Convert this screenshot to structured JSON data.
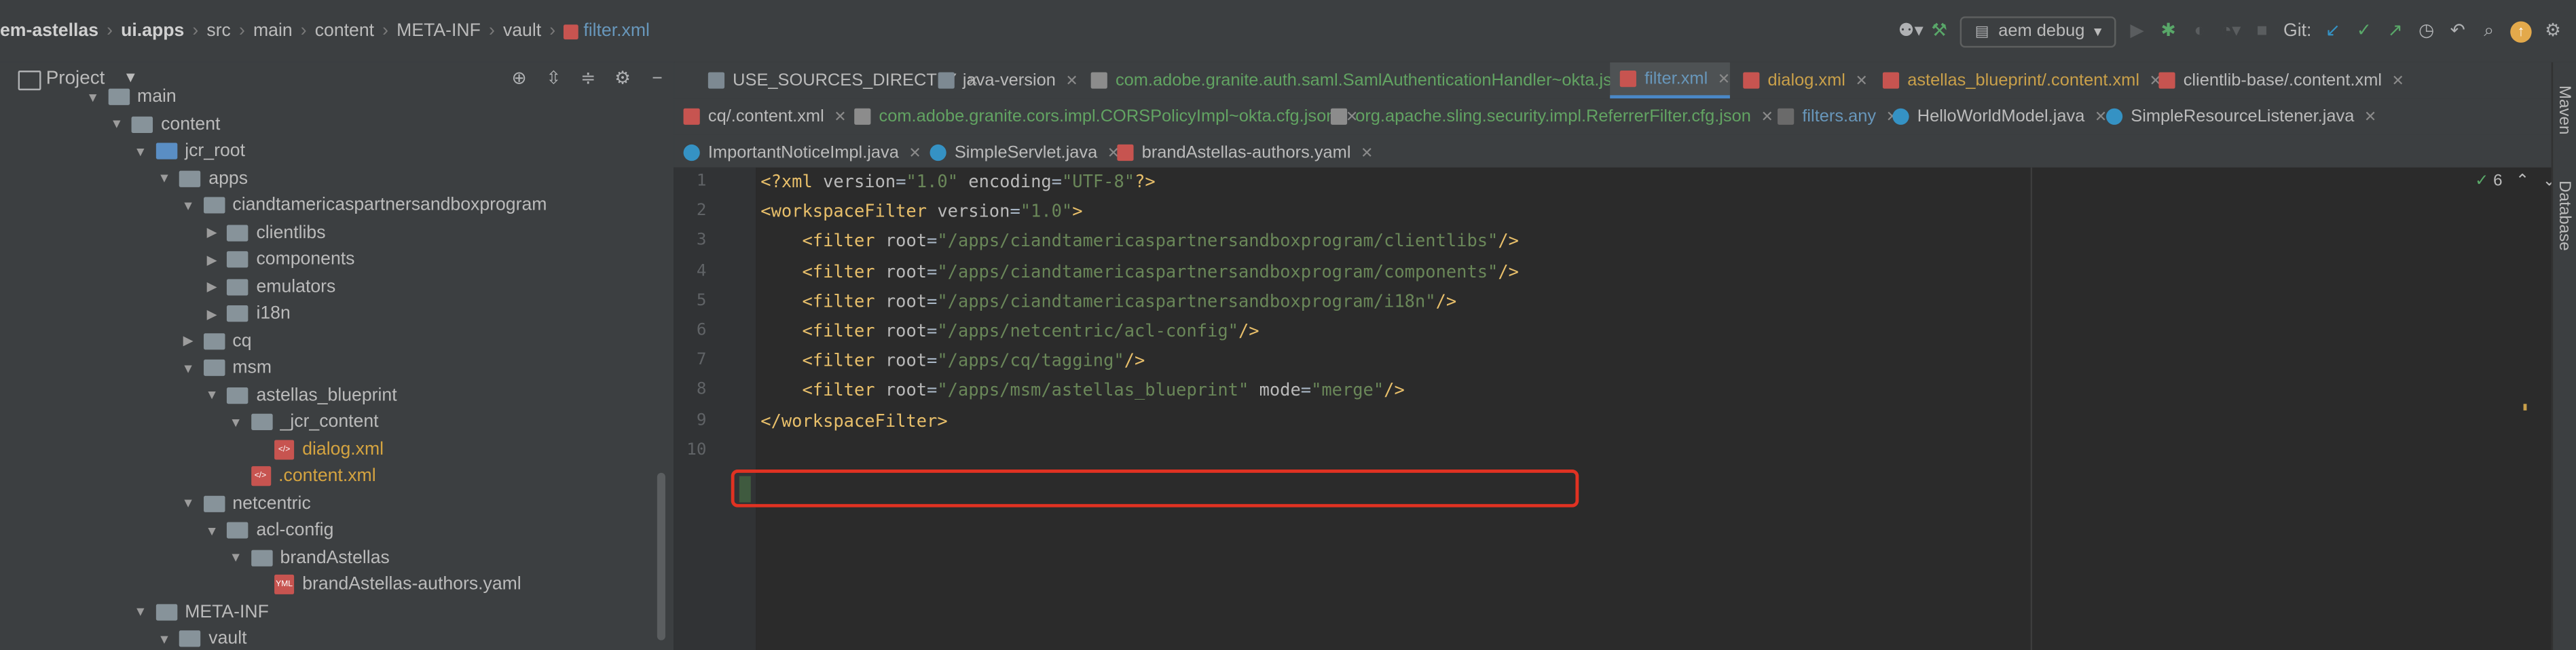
{
  "breadcrumb": {
    "items": [
      "em-astellas",
      "ui.apps",
      "src",
      "main",
      "content",
      "META-INF",
      "vault"
    ],
    "file": "filter.xml"
  },
  "toolbar": {
    "run_config": "aem debug",
    "git_label": "Git:"
  },
  "sidebar": {
    "title": "Project",
    "tree": [
      {
        "label": "main",
        "depth": 3,
        "kind": "folder",
        "open": true
      },
      {
        "label": "content",
        "depth": 4,
        "kind": "folder",
        "open": true
      },
      {
        "label": "jcr_root",
        "depth": 5,
        "kind": "folder-blue",
        "open": true
      },
      {
        "label": "apps",
        "depth": 6,
        "kind": "folder",
        "open": true
      },
      {
        "label": "ciandtamericaspartnersandboxprogram",
        "depth": 7,
        "kind": "folder",
        "open": true
      },
      {
        "label": "clientlibs",
        "depth": 8,
        "kind": "folder",
        "open": false
      },
      {
        "label": "components",
        "depth": 8,
        "kind": "folder",
        "open": false
      },
      {
        "label": "emulators",
        "depth": 8,
        "kind": "folder",
        "open": false
      },
      {
        "label": "i18n",
        "depth": 8,
        "kind": "folder",
        "open": false
      },
      {
        "label": "cq",
        "depth": 7,
        "kind": "folder",
        "open": false
      },
      {
        "label": "msm",
        "depth": 7,
        "kind": "folder",
        "open": true
      },
      {
        "label": "astellas_blueprint",
        "depth": 8,
        "kind": "folder",
        "open": true
      },
      {
        "label": "_jcr_content",
        "depth": 9,
        "kind": "folder",
        "open": true
      },
      {
        "label": "dialog.xml",
        "depth": 10,
        "kind": "xml",
        "open": null
      },
      {
        "label": ".content.xml",
        "depth": 9,
        "kind": "xml",
        "open": null
      },
      {
        "label": "netcentric",
        "depth": 7,
        "kind": "folder",
        "open": true
      },
      {
        "label": "acl-config",
        "depth": 8,
        "kind": "folder",
        "open": true
      },
      {
        "label": "brandAstellas",
        "depth": 9,
        "kind": "folder",
        "open": true
      },
      {
        "label": "brandAstellas-authors.yaml",
        "depth": 10,
        "kind": "yaml",
        "open": null
      },
      {
        "label": "META-INF",
        "depth": 5,
        "kind": "folder",
        "open": true
      },
      {
        "label": "vault",
        "depth": 6,
        "kind": "folder",
        "open": true
      }
    ]
  },
  "tabs": {
    "row1": [
      {
        "label": "USE_SOURCES_DIRECTLY",
        "icon": "txt",
        "color": "default",
        "active": false
      },
      {
        "label": "java-version",
        "icon": "txt",
        "color": "default",
        "active": false
      },
      {
        "label": "com.adobe.granite.auth.saml.SamlAuthenticationHandler~okta.json",
        "icon": "json",
        "color": "green",
        "active": false
      },
      {
        "label": "filter.xml",
        "icon": "xml",
        "color": "blue",
        "active": true
      },
      {
        "label": "dialog.xml",
        "icon": "xml",
        "color": "orange",
        "active": false
      },
      {
        "label": "astellas_blueprint/.content.xml",
        "icon": "xml",
        "color": "orange",
        "active": false
      },
      {
        "label": "clientlib-base/.content.xml",
        "icon": "xml",
        "color": "default",
        "active": false
      }
    ],
    "row2": [
      {
        "label": "cq/.content.xml",
        "icon": "xml",
        "color": "default",
        "active": false
      },
      {
        "label": "com.adobe.granite.cors.impl.CORSPolicyImpl~okta.cfg.json",
        "icon": "json",
        "color": "green",
        "active": false
      },
      {
        "label": "org.apache.sling.security.impl.ReferrerFilter.cfg.json",
        "icon": "json",
        "color": "green",
        "active": false
      },
      {
        "label": "filters.any",
        "icon": "any",
        "color": "blue",
        "active": false
      },
      {
        "label": "HelloWorldModel.java",
        "icon": "java",
        "color": "default",
        "active": false
      },
      {
        "label": "SimpleResourceListener.java",
        "icon": "java",
        "color": "default",
        "active": false
      }
    ],
    "row3": [
      {
        "label": "ImportantNoticeImpl.java",
        "icon": "java",
        "color": "default",
        "active": false
      },
      {
        "label": "SimpleServlet.java",
        "icon": "java",
        "color": "default",
        "active": false
      },
      {
        "label": "brandAstellas-authors.yaml",
        "icon": "yaml",
        "color": "default",
        "active": false
      }
    ]
  },
  "editor": {
    "inspection_count": "6",
    "lines": [
      {
        "n": "1",
        "segments": [
          {
            "t": "<?xml ",
            "c": "tagc"
          },
          {
            "t": "version",
            "c": "attr"
          },
          {
            "t": "=",
            "c": "pun"
          },
          {
            "t": "\"1.0\"",
            "c": "val"
          },
          {
            "t": " encoding",
            "c": "attr"
          },
          {
            "t": "=",
            "c": "pun"
          },
          {
            "t": "\"UTF-8\"",
            "c": "val"
          },
          {
            "t": "?>",
            "c": "tagc"
          }
        ]
      },
      {
        "n": "2",
        "segments": [
          {
            "t": "<workspaceFilter ",
            "c": "tagc"
          },
          {
            "t": "version",
            "c": "attr"
          },
          {
            "t": "=",
            "c": "pun"
          },
          {
            "t": "\"1.0\"",
            "c": "val"
          },
          {
            "t": ">",
            "c": "tagc"
          }
        ]
      },
      {
        "n": "3",
        "segments": [
          {
            "t": "    <filter ",
            "c": "tagc"
          },
          {
            "t": "root",
            "c": "attr"
          },
          {
            "t": "=",
            "c": "pun"
          },
          {
            "t": "\"/apps/ciandtamericaspartnersandboxprogram/clientlibs\"",
            "c": "val"
          },
          {
            "t": "/>",
            "c": "tagc"
          }
        ]
      },
      {
        "n": "4",
        "segments": [
          {
            "t": "    <filter ",
            "c": "tagc"
          },
          {
            "t": "root",
            "c": "attr"
          },
          {
            "t": "=",
            "c": "pun"
          },
          {
            "t": "\"/apps/ciandtamericaspartnersandboxprogram/components\"",
            "c": "val"
          },
          {
            "t": "/>",
            "c": "tagc"
          }
        ]
      },
      {
        "n": "5",
        "segments": [
          {
            "t": "    <filter ",
            "c": "tagc"
          },
          {
            "t": "root",
            "c": "attr"
          },
          {
            "t": "=",
            "c": "pun"
          },
          {
            "t": "\"/apps/ciandtamericaspartnersandboxprogram/i18n\"",
            "c": "val"
          },
          {
            "t": "/>",
            "c": "tagc"
          }
        ]
      },
      {
        "n": "6",
        "segments": [
          {
            "t": "    <filter ",
            "c": "tagc"
          },
          {
            "t": "root",
            "c": "attr"
          },
          {
            "t": "=",
            "c": "pun"
          },
          {
            "t": "\"/apps/netcentric/acl-config\"",
            "c": "val"
          },
          {
            "t": "/>",
            "c": "tagc"
          }
        ]
      },
      {
        "n": "7",
        "segments": [
          {
            "t": "    <filter ",
            "c": "tagc"
          },
          {
            "t": "root",
            "c": "attr"
          },
          {
            "t": "=",
            "c": "pun"
          },
          {
            "t": "\"/apps/cq/tagging\"",
            "c": "val"
          },
          {
            "t": "/>",
            "c": "tagc"
          }
        ]
      },
      {
        "n": "8",
        "segments": [
          {
            "t": "    <filter ",
            "c": "tagc"
          },
          {
            "t": "root",
            "c": "attr"
          },
          {
            "t": "=",
            "c": "pun"
          },
          {
            "t": "\"/apps/msm/astellas_blueprint\"",
            "c": "val"
          },
          {
            "t": " mode",
            "c": "attr"
          },
          {
            "t": "=",
            "c": "pun"
          },
          {
            "t": "\"merge\"",
            "c": "val"
          },
          {
            "t": "/>",
            "c": "tagc"
          }
        ]
      },
      {
        "n": "9",
        "segments": [
          {
            "t": "</workspaceFilter>",
            "c": "tagc"
          }
        ]
      },
      {
        "n": "10",
        "segments": []
      }
    ]
  },
  "right_tool_windows": [
    "Maven",
    "Database"
  ],
  "colors": {
    "accent": "#4a88c7",
    "highlight_box": "#e03222",
    "tag": "#e8bf6a",
    "string": "#6a8759"
  }
}
